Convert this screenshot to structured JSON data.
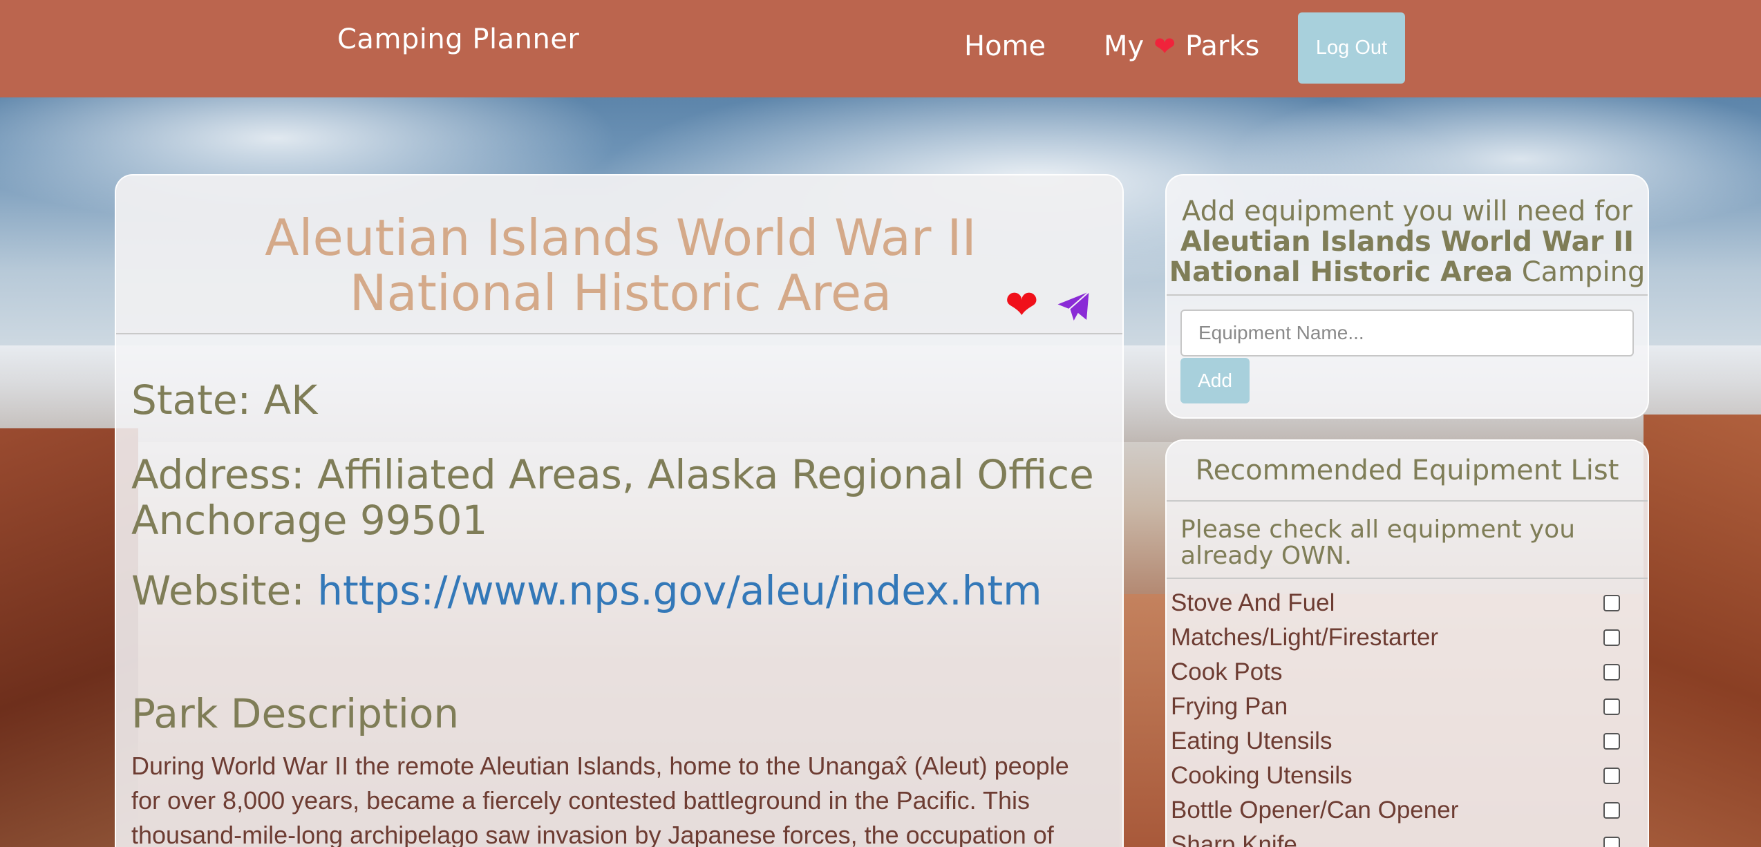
{
  "navbar": {
    "brand": "Camping Planner",
    "home": "Home",
    "my_parks_prefix": "My",
    "my_parks_suffix": "Parks",
    "logout": "Log Out"
  },
  "park": {
    "title": "Aleutian Islands World War II National Historic Area",
    "state_label": "State:",
    "state": "AK",
    "address_label": "Address:",
    "address": "Affiliated Areas, Alaska Regional Office Anchorage 99501",
    "website_label": "Website:",
    "website": "https://www.nps.gov/aleu/index.htm",
    "description_heading": "Park Description",
    "description": "During World War II the remote Aleutian Islands, home to the Unangax̂ (Aleut) people for over 8,000 years, became a fiercely contested battleground in the Pacific. This thousand-mile-long archipelago saw invasion by Japanese forces, the occupation of"
  },
  "add_equipment": {
    "heading_prefix": "Add equipment you will need for",
    "heading_park": "Aleutian Islands World War II National Historic Area",
    "heading_suffix": "Camping",
    "input_placeholder": "Equipment Name...",
    "input_value": "",
    "add_button": "Add"
  },
  "recommended": {
    "heading": "Recommended Equipment List",
    "instructions": "Please check all equipment you already OWN.",
    "items": [
      {
        "label": "Stove And Fuel",
        "checked": false
      },
      {
        "label": "Matches/Light/Firestarter",
        "checked": false
      },
      {
        "label": "Cook Pots",
        "checked": false
      },
      {
        "label": "Frying Pan",
        "checked": false
      },
      {
        "label": "Eating Utensils",
        "checked": false
      },
      {
        "label": "Cooking Utensils",
        "checked": false
      },
      {
        "label": "Bottle Opener/Can Opener",
        "checked": false
      },
      {
        "label": "Sharp Knife",
        "checked": false
      }
    ]
  },
  "icons": {
    "heart": "heart-icon",
    "send": "paper-plane-icon"
  },
  "colors": {
    "navbar": "#bb654e",
    "button": "#a8d0dc",
    "title": "#d4a989",
    "label": "#7f7d57",
    "link": "#3378b8",
    "body_text": "#6d3c32",
    "heart": "#f0101a",
    "send": "#8a2bd6"
  }
}
